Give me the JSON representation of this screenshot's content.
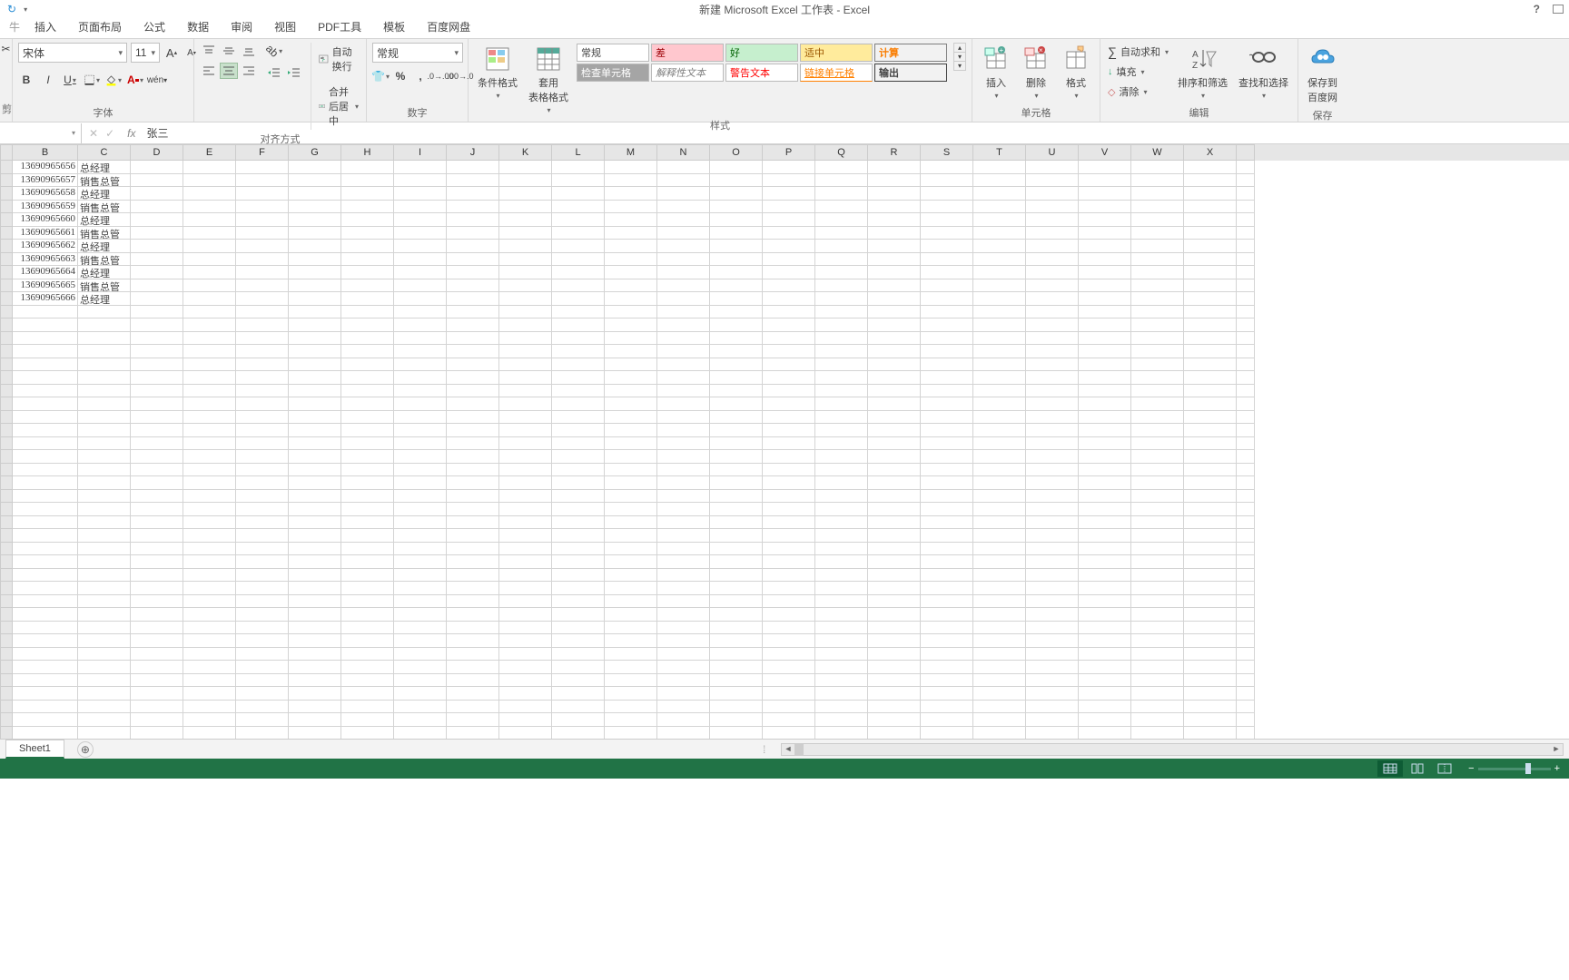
{
  "title": "新建 Microsoft Excel 工作表 - Excel",
  "tabs": {
    "file": "文件",
    "insert": "插入",
    "layout": "页面布局",
    "formulas": "公式",
    "data": "数据",
    "review": "审阅",
    "view": "视图",
    "pdf": "PDF工具",
    "template": "模板",
    "baidu": "百度网盘"
  },
  "ribbon": {
    "font": {
      "name": "宋体",
      "size": "11",
      "group": "字体"
    },
    "align": {
      "wrap": "自动换行",
      "merge": "合并后居中",
      "group": "对齐方式"
    },
    "number": {
      "format": "常规",
      "group": "数字"
    },
    "condfmt": "条件格式",
    "tablefmt": "套用\n表格格式",
    "styles": {
      "normal": "常规",
      "bad": "差",
      "good": "好",
      "neutral": "适中",
      "check": "检查单元格",
      "explain": "解释性文本",
      "warn": "警告文本",
      "link": "链接单元格",
      "calc": "计算",
      "output": "输出",
      "group": "样式"
    },
    "cells": {
      "insert": "插入",
      "delete": "删除",
      "format": "格式",
      "group": "单元格"
    },
    "editing": {
      "sum": "自动求和",
      "fill": "填充",
      "clear": "清除",
      "sort": "排序和筛选",
      "find": "查找和选择",
      "group": "编辑"
    },
    "cloud": {
      "save": "保存到\n百度网",
      "group": "保存"
    }
  },
  "fbar": {
    "name": "",
    "fx": "fx",
    "value": "张三"
  },
  "columns": [
    "B",
    "C",
    "D",
    "E",
    "F",
    "G",
    "H",
    "I",
    "J",
    "K",
    "L",
    "M",
    "N",
    "O",
    "P",
    "Q",
    "R",
    "S",
    "T",
    "U",
    "V",
    "W",
    "X"
  ],
  "data_rows": [
    {
      "b": "13690965656",
      "c": "总经理"
    },
    {
      "b": "13690965657",
      "c": "销售总管"
    },
    {
      "b": "13690965658",
      "c": "总经理"
    },
    {
      "b": "13690965659",
      "c": "销售总管"
    },
    {
      "b": "13690965660",
      "c": "总经理"
    },
    {
      "b": "13690965661",
      "c": "销售总管"
    },
    {
      "b": "13690965662",
      "c": "总经理"
    },
    {
      "b": "13690965663",
      "c": "销售总管"
    },
    {
      "b": "13690965664",
      "c": "总经理"
    },
    {
      "b": "13690965665",
      "c": "销售总管"
    },
    {
      "b": "13690965666",
      "c": "总经理"
    }
  ],
  "sheet": "Sheet1"
}
